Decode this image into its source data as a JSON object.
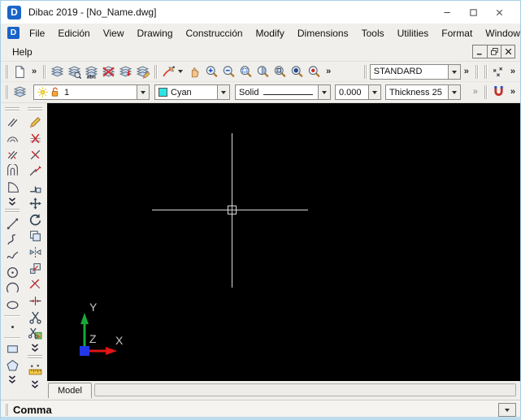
{
  "window": {
    "app_icon_letter": "D",
    "title": "Dibac 2019 - [No_Name.dwg]",
    "controls": [
      "minimize",
      "maximize",
      "close"
    ]
  },
  "menubar": {
    "doc_icon_letter": "D",
    "row1_items": [
      "File",
      "Edición",
      "View",
      "Drawing",
      "Construcción",
      "Modify",
      "Dimensions",
      "Tools",
      "Utilities",
      "Format",
      "Window"
    ],
    "row2_items": [
      "Help"
    ],
    "mdi_controls": [
      "minimize",
      "restore",
      "close"
    ]
  },
  "ui": {
    "overflow_glyph": "»"
  },
  "toolbar_row1": {
    "group_file": [
      "grip",
      "new-file",
      "over"
    ],
    "group_layers": [
      "grip",
      "layer-properties",
      "layer-find",
      "layer-text",
      "layer-off",
      "layer-down",
      "layer-edit"
    ],
    "group_zoom": [
      "grip",
      "redline-pen",
      "drop",
      "pan-hand",
      "zoom-in",
      "zoom-out",
      "zoom-window",
      "zoom-previous",
      "zoom-dynamic",
      "zoom-object",
      "zoom-center",
      "over"
    ],
    "style_combo": {
      "value": "STANDARD"
    },
    "group_point": [
      "grip",
      "point-style",
      "over"
    ]
  },
  "toolbar_row2": {
    "group_layers": [
      "grip",
      "layers"
    ],
    "layer_combo": {
      "value": "1",
      "status_icons": [
        "layer-on",
        "lock-open"
      ]
    },
    "color_combo": {
      "value": "Cyan",
      "swatch_hex": "#2ee4e4"
    },
    "linetype_combo": {
      "value": "Solid"
    },
    "lineweight_combo": {
      "value": "0.000"
    },
    "thickness_combo": {
      "value": "Thickness 25"
    },
    "group_snap": [
      "grip",
      "magnet",
      "over"
    ]
  },
  "draw_toolbar": {
    "items": [
      "grip",
      "parallel-lines",
      "double-arc",
      "offset-lines",
      "wall",
      "door-arc",
      "more",
      "grip",
      "line",
      "polyline",
      "spline",
      "circle",
      "arc",
      "ellipse",
      "sep",
      "point",
      "sep",
      "rectangle",
      "polygon",
      "more"
    ]
  },
  "modify_toolbar": {
    "items": [
      "grip",
      "sketch-pencil",
      "erase",
      "break",
      "offset-arrow",
      "corner",
      "move",
      "rotate",
      "copy",
      "mirror",
      "scale",
      "trim",
      "extend",
      "scissors",
      "cut-color",
      "more",
      "grip",
      "ruler",
      "more"
    ]
  },
  "canvas": {
    "background_hex": "#000000",
    "crosshair_hex": "#d9d9d9"
  },
  "ucs_icon": {
    "x_label": "X",
    "y_label": "Y",
    "z_label": "Z",
    "x_color": "#e01414",
    "y_color": "#18a83c",
    "z_color": "#2238e8",
    "label_color": "#c4c4c4"
  },
  "tab_bar": {
    "tabs": [
      "Model"
    ]
  },
  "command_line": {
    "prompt": "Comma"
  }
}
